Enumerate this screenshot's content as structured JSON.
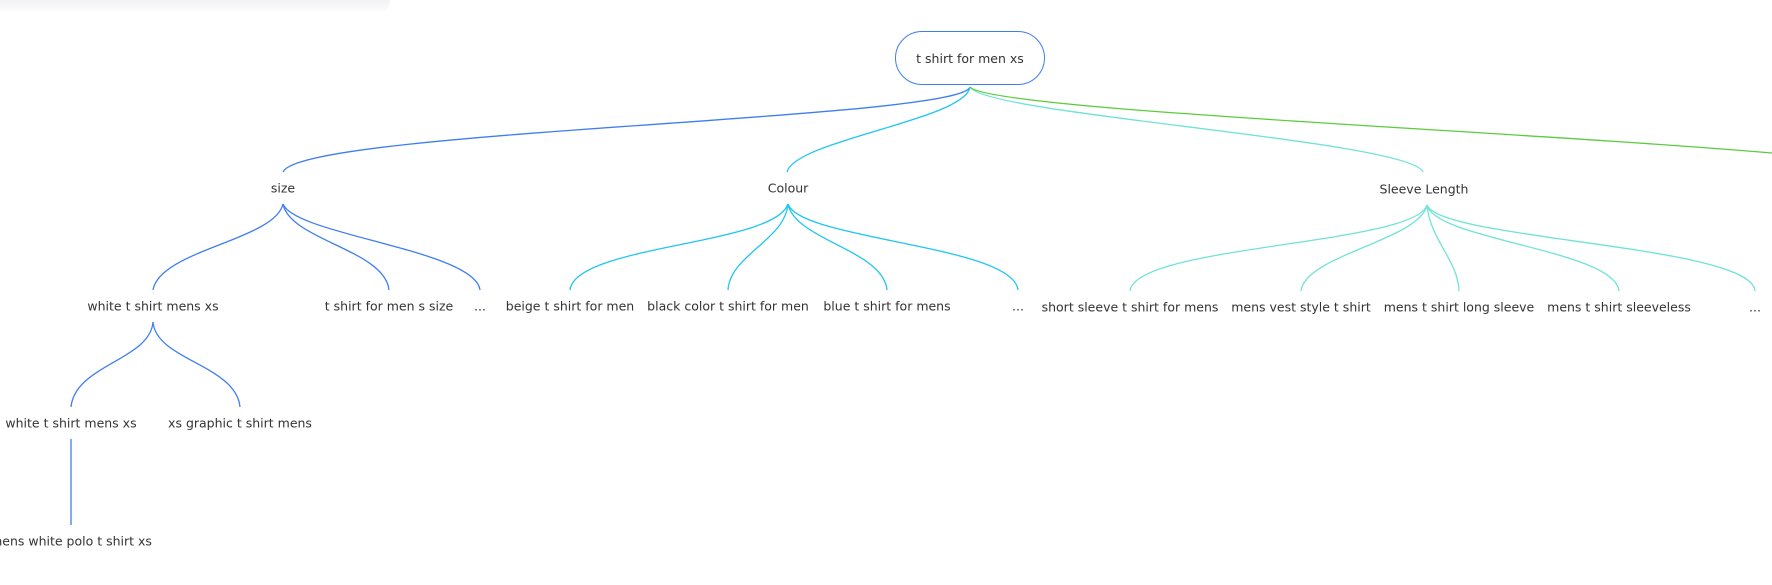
{
  "colors": {
    "size_branch": "#3f7ef0",
    "colour_branch": "#1ec6ef",
    "sleeve_branch": "#6fe3d6",
    "extra_branch": "#5ccc3c",
    "root_border": "#3f7ef0",
    "text": "#333333"
  },
  "root": {
    "label": "t shirt for men xs"
  },
  "branches": [
    {
      "label": "size",
      "children": [
        {
          "label": "white t shirt mens xs",
          "children": [
            {
              "label": "white t shirt mens xs",
              "children": [
                {
                  "label": "mens white polo t shirt xs"
                }
              ]
            },
            {
              "label": "xs graphic t shirt mens"
            }
          ]
        },
        {
          "label": "t shirt for men s size"
        },
        {
          "label": "..."
        }
      ]
    },
    {
      "label": "Colour",
      "children": [
        {
          "label": "beige t shirt for men"
        },
        {
          "label": "black color t shirt for men"
        },
        {
          "label": "blue t shirt for mens"
        },
        {
          "label": "..."
        }
      ]
    },
    {
      "label": "Sleeve Length",
      "children": [
        {
          "label": "short sleeve t shirt for mens"
        },
        {
          "label": "mens vest style t shirt"
        },
        {
          "label": "mens t shirt long sleeve"
        },
        {
          "label": "mens t shirt sleeveless"
        },
        {
          "label": "..."
        }
      ]
    }
  ]
}
